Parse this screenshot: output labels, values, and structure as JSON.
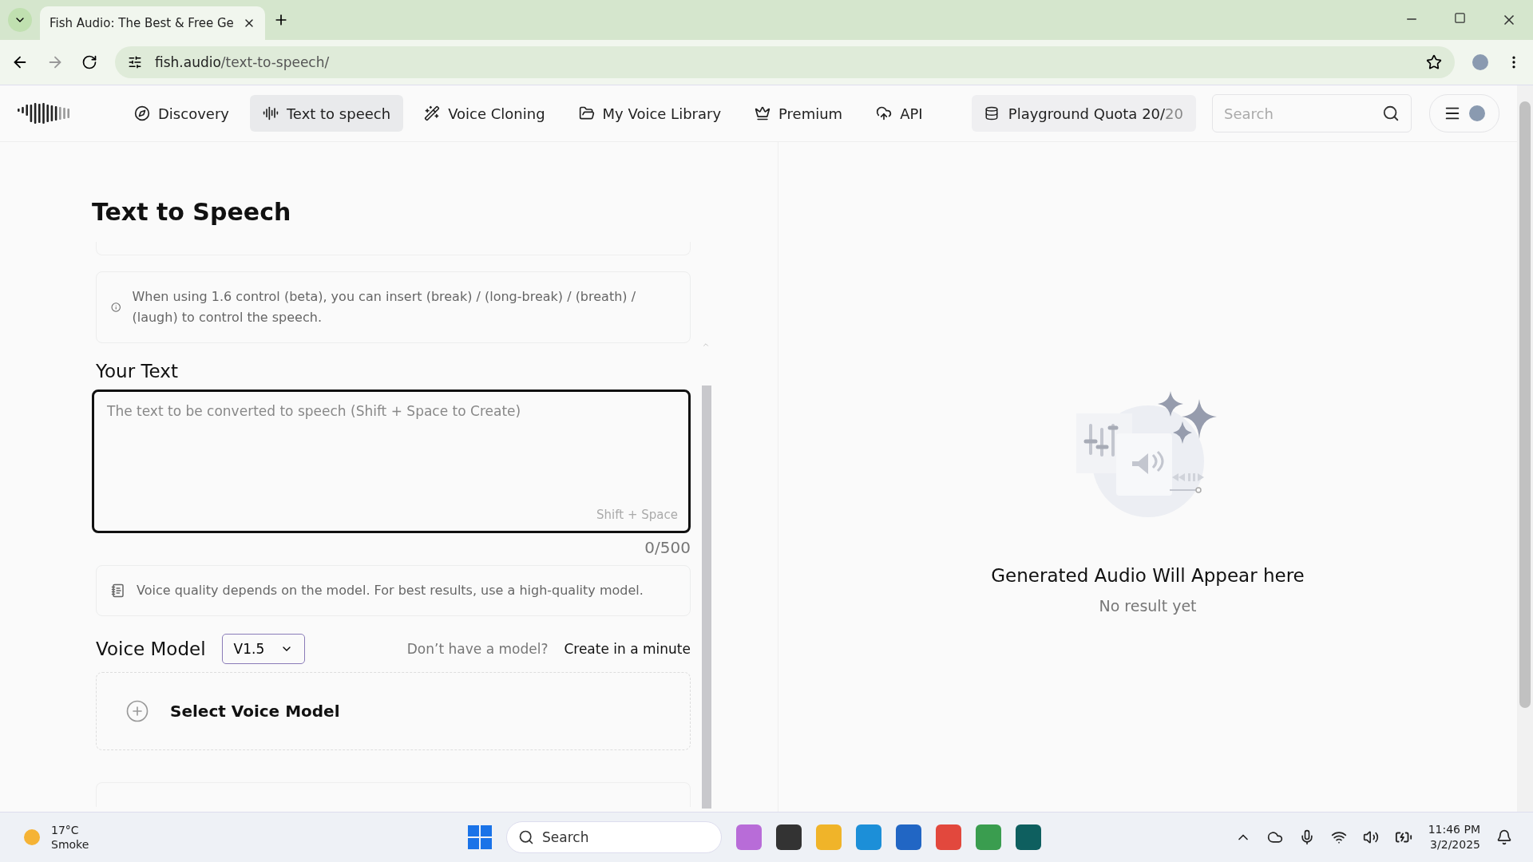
{
  "browser": {
    "tabs": [
      {
        "title": "Fish Audio: The Best & Free Ge",
        "selected": true
      }
    ],
    "url_host": "fish.audio",
    "url_path": "/text-to-speech/"
  },
  "nav": {
    "items": [
      {
        "label": "Discovery",
        "kind": "discovery",
        "selected": false
      },
      {
        "label": "Text to speech",
        "kind": "tts",
        "selected": true
      },
      {
        "label": "Voice Cloning",
        "kind": "cloning",
        "selected": false
      },
      {
        "label": "My Voice Library",
        "kind": "library",
        "selected": false
      },
      {
        "label": "Premium",
        "kind": "premium",
        "selected": false
      },
      {
        "label": "API",
        "kind": "api",
        "selected": false
      }
    ],
    "quota_label": "Playground Quota 20/",
    "quota_total": "20",
    "search": {
      "placeholder": "Search"
    }
  },
  "page": {
    "title": "Text to Speech",
    "notice": "When using 1.6 control (beta), you can insert (break) / (long-break) / (breath) / (laugh) to control the speech.",
    "your_text_label": "Your Text",
    "text_placeholder": "The text to be converted to speech (Shift + Space to Create)",
    "shortcut_hint": "Shift + Space",
    "counter": "0/500",
    "quality_note": "Voice quality depends on the model. For best results, use a high-quality model.",
    "voice_model_label": "Voice Model",
    "model_version": "V1.5",
    "no_model_prompt": "Don’t have a model?",
    "create_link": "Create in a minute",
    "select_model": "Select Voice Model"
  },
  "result": {
    "title": "Generated Audio Will Appear here",
    "subtitle": "No result yet"
  },
  "taskbar": {
    "weather_temp": "17°C",
    "weather_desc": "Smoke",
    "search_label": "Search",
    "time": "11:46 PM",
    "date": "3/2/2025"
  }
}
